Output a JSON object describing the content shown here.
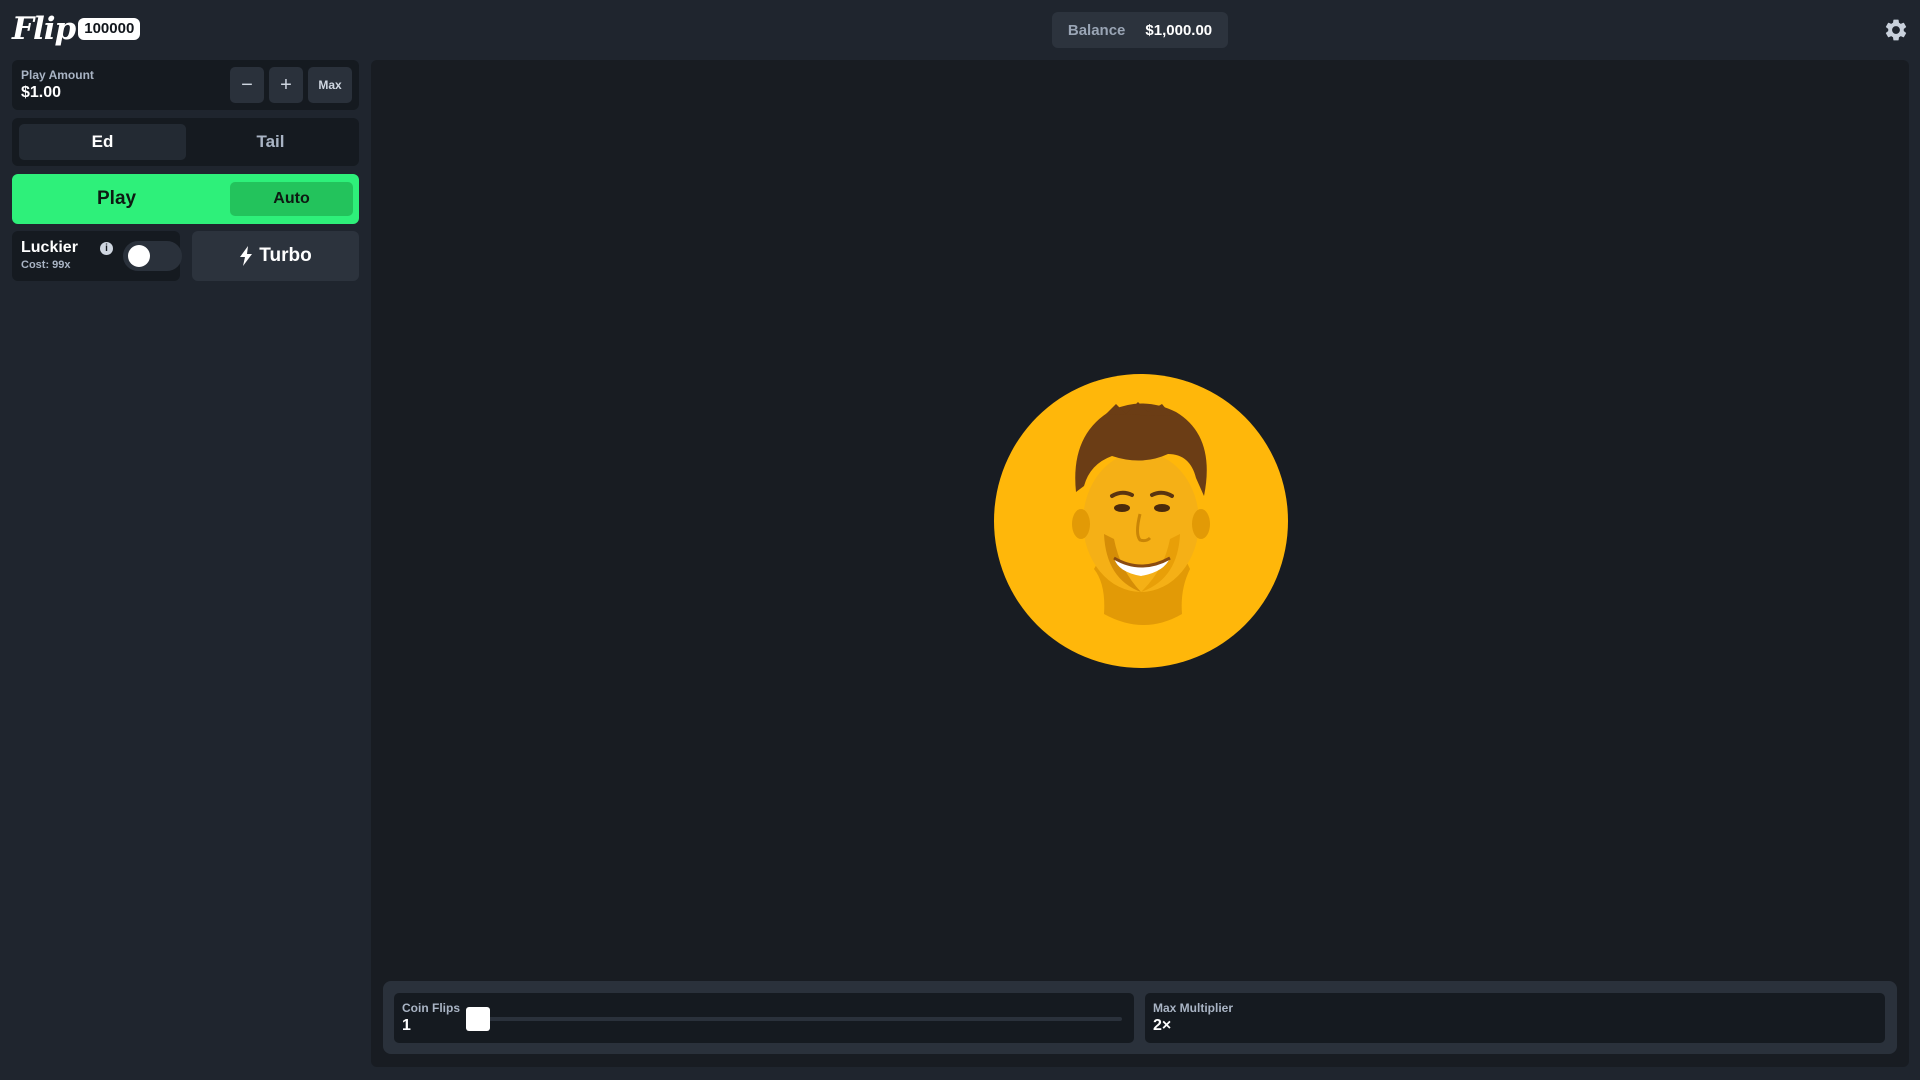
{
  "header": {
    "logo_text": "Flip",
    "logo_badge": "100000",
    "balance_label": "Balance",
    "balance_value": "$1,000.00",
    "settings_icon": "gear-icon"
  },
  "controls": {
    "play_amount_label": "Play Amount",
    "play_amount_value": "$1.00",
    "minus_label": "−",
    "plus_label": "+",
    "max_label": "Max",
    "side_options": [
      "Ed",
      "Tail"
    ],
    "selected_side": "Ed",
    "play_label": "Play",
    "auto_label": "Auto",
    "luckier_label": "Luckier",
    "luckier_cost": "Cost: 99x",
    "luckier_enabled": false,
    "turbo_label": "Turbo"
  },
  "game": {
    "coin_face": "Ed",
    "coin_flips_label": "Coin Flips",
    "coin_flips_value": "1",
    "max_multiplier_label": "Max Multiplier",
    "max_multiplier_value": "2×"
  },
  "colors": {
    "accent_green": "#2ef07a",
    "auto_green": "#23c35c",
    "coin_gold": "#ffb70a",
    "background": "#1f252e"
  }
}
